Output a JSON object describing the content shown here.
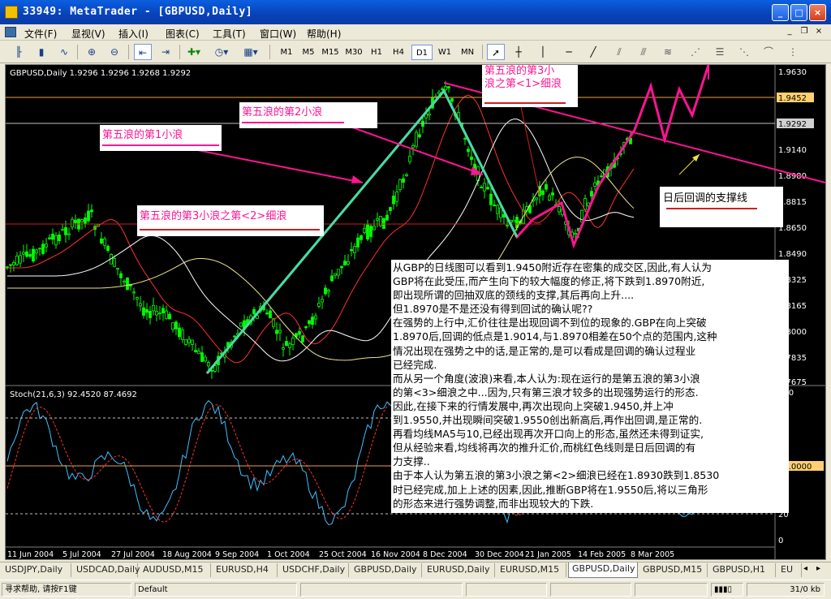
{
  "window": {
    "title": "33949: MetaTrader - [GBPUSD,Daily]"
  },
  "menu": [
    "文件(F)",
    "显视(V)",
    "插入(I)",
    "图表(C)",
    "工具(T)",
    "窗口(W)",
    "帮助(H)"
  ],
  "timeframes": [
    "M1",
    "M5",
    "M15",
    "M30",
    "H1",
    "H4",
    "D1",
    "W1",
    "MN"
  ],
  "active_timeframe": "D1",
  "chart": {
    "symbol_info": "GBPUSD,Daily  1.9296 1.9296 1.9268 1.9292",
    "price_ticks": [
      "1.9630",
      "1.9452",
      "1.9292",
      "1.9140",
      "1.8980",
      "1.8815",
      "1.8650",
      "1.8490",
      "1.8325",
      "1.8165",
      "1.8000",
      "1.7835",
      "1.7675"
    ],
    "current_price": "1.9452",
    "bid_price": "1.9292",
    "date_ticks": [
      "11 Jun 2004",
      "5 Jul 2004",
      "27 Jul 2004",
      "18 Aug 2004",
      "9 Sep 2004",
      "1 Oct 2004",
      "25 Oct 2004",
      "16 Nov 2004",
      "8 Dec 2004",
      "30 Dec 2004",
      "21 Jan 2005",
      "14 Feb 2005",
      "8 Mar 2005"
    ],
    "stoch_label": "Stoch(21,6,3) 92.4520 87.4692",
    "stoch_ticks": [
      "100",
      "80",
      "50.0000",
      "20",
      "0"
    ],
    "colors": {
      "up_candle": "#00ff00",
      "down_candle": "#00ff00",
      "wave_line": "#40e0a0",
      "pink": "#ff1493",
      "ma_white": "#ffffff",
      "ma_yellow": "#f0e68c",
      "ma_red": "#ff4040"
    }
  },
  "labels": {
    "wave1": "第五浪的第1小浪",
    "wave2": "第五浪的第2小浪",
    "wave3a": "第五浪的第3小",
    "wave3b": "浪之第<1>细浪",
    "wave3sub2": "第五浪的第3小浪之第<2>细浪",
    "support": "日后回调的支撑线"
  },
  "commentary": [
    "从GBP的日线图可以看到1.9450附近存在密集的成交区,因此,有人认为",
    "GBP将在此受压,而产生向下的较大幅度的修正,将下跌到1.8970附近,",
    "即出现所谓的回抽双底的颈线的支撑,其后再向上升....",
    "但1.8970是不是还没有得到回试的确认呢??",
    "在强势的上行中,汇价往往是出现回调不到位的现象的.GBP在向上突破",
    "1.8970后,回调的低点是1.9014,与1.8970相差在50个点的范围内,这种",
    "情况出现在强势之中的话,是正常的,是可以看成是回调的确认过程业",
    "已经完成.",
    "而从另一个角度(波浪)来看,本人认为:现在运行的是第五浪的第3小浪",
    "的第<3>细浪之中...因为,只有第三浪才较多的出现强势运行的形态.",
    "因此,在接下来的行情发展中,再次出现向上突破1.9450,并上冲",
    "到1.9550,并出现瞬间突破1.9550创出新高后,再作出回调,是正常的.",
    "再看均线MA5与10,已经出现再次开口向上的形态,虽然还未得到证实,",
    "但从经验来看,均线将再次的推升汇价,而桃红色线则是日后回调的有",
    "力支撑..",
    "由于本人认为第五浪的第3小浪之第<2>细浪已经在1.8930跌到1.8530",
    "时已经完成,加上上述的因素,因此,推断GBP将在1.9550后,将以三角形",
    "的形态来进行强势调整,而非出现较大的下跌."
  ],
  "tabs": [
    "USDJPY,Daily",
    "USDCAD,Daily",
    "AUDUSD,M15",
    "EURUSD,H4",
    "USDCHF,Daily",
    "GBPUSD,Daily",
    "EURUSD,Daily",
    "EURUSD,M15",
    "GBPUSD,Daily",
    "GBPUSD,M15",
    "GBPUSD,H1",
    "EU"
  ],
  "active_tab": 8,
  "status": {
    "help": "寻求帮助, 请按F1键",
    "profile": "Default",
    "traffic": "31/0 kb"
  }
}
